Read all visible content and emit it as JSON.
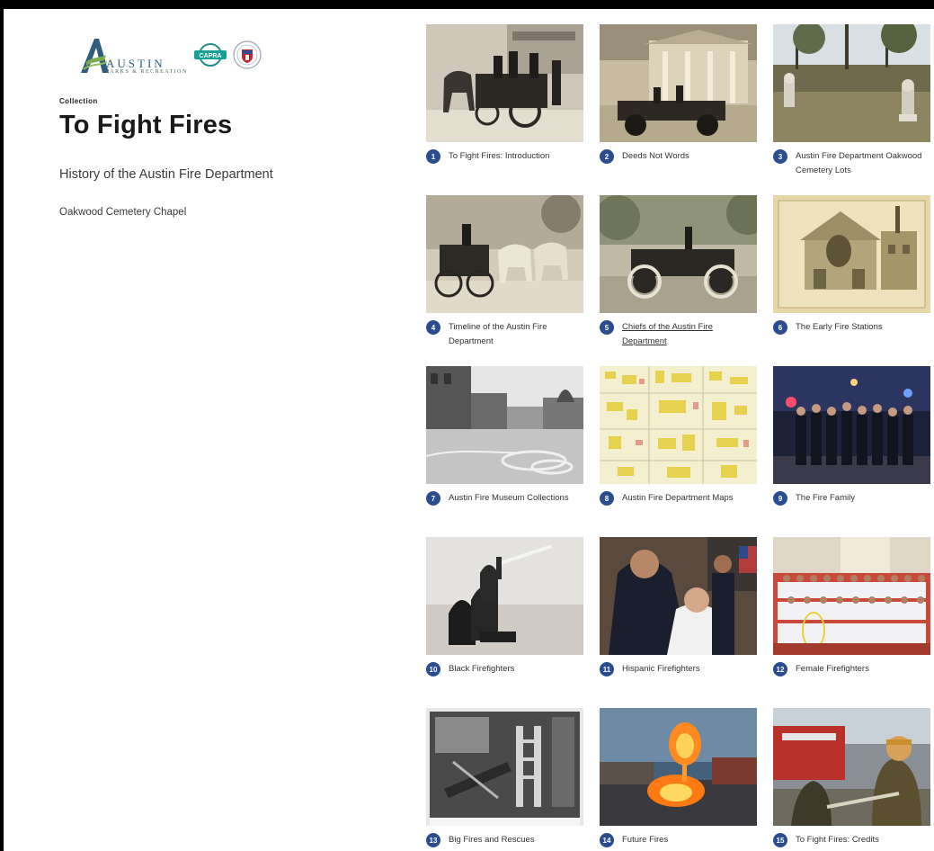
{
  "header": {
    "logos": {
      "parks_line1": "AUSTIN",
      "parks_line2": "PARKS & RECREATION",
      "capra": "CAPRA"
    },
    "eyebrow": "Collection",
    "title": "To Fight Fires",
    "subtitle": "History of the Austin Fire Department",
    "location": "Oakwood Cemetery Chapel"
  },
  "colors": {
    "badge": "#2b4c8f",
    "text": "#333333",
    "title": "#1a1a1a"
  },
  "items": [
    {
      "num": "1",
      "label": "To Fight Fires: Introduction",
      "image": "horse-drawn-fire-engine-photo"
    },
    {
      "num": "2",
      "label": "Deeds Not Words",
      "image": "early-fire-car-in-front-of-house-photo"
    },
    {
      "num": "3",
      "label": "Austin Fire Department Oakwood Cemetery Lots",
      "image": "cemetery-hydrant-markers-photo"
    },
    {
      "num": "4",
      "label": "Timeline of the Austin Fire Department",
      "image": "horse-drawn-carriage-photo"
    },
    {
      "num": "5",
      "label": "Chiefs of the Austin Fire Department",
      "image": "chief-antique-car-photo"
    },
    {
      "num": "6",
      "label": "The Early Fire Stations",
      "image": "early-fire-station-postcard"
    },
    {
      "num": "7",
      "label": "Austin Fire Museum Collections",
      "image": "congress-avenue-hoses-photo"
    },
    {
      "num": "8",
      "label": "Austin Fire Department Maps",
      "image": "sanborn-fire-map"
    },
    {
      "num": "9",
      "label": "The Fire Family",
      "image": "firefighters-at-night-photo"
    },
    {
      "num": "10",
      "label": "Black Firefighters",
      "image": "black-firefighters-hose-photo"
    },
    {
      "num": "11",
      "label": "Hispanic Firefighters",
      "image": "pinning-ceremony-photo"
    },
    {
      "num": "12",
      "label": "Female Firefighters",
      "image": "female-firefighters-group-photo"
    },
    {
      "num": "13",
      "label": "Big Fires and Rescues",
      "image": "burned-building-interior-photo"
    },
    {
      "num": "14",
      "label": "Future Fires",
      "image": "fire-training-fireball-photo"
    },
    {
      "num": "15",
      "label": "To Fight Fires: Credits",
      "image": "firefighter-hose-training-photo"
    }
  ]
}
